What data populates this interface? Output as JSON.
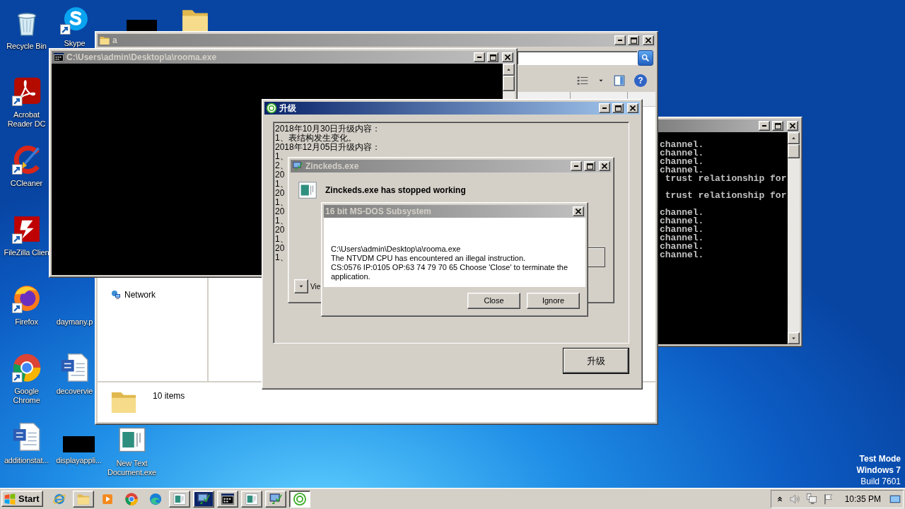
{
  "desktop_icons": [
    {
      "kind": "recycle-bin",
      "label": "Recycle Bin",
      "shortcut": false
    },
    {
      "kind": "chat-app",
      "label": "Skype",
      "shortcut": true
    },
    {
      "kind": "redacted"
    },
    {
      "kind": "folder",
      "shortcut": false
    },
    {
      "kind": "pdf-app",
      "label": "Acrobat Reader DC",
      "shortcut": true
    },
    {
      "kind": "cleaner-app",
      "label": "CCleaner",
      "shortcut": true
    },
    {
      "kind": "ftp-app",
      "label": "FileZilla Clien",
      "shortcut": true
    },
    {
      "kind": "fox-browser",
      "label": "Firefox",
      "shortcut": true
    },
    {
      "kind": "blank",
      "label": "daymany.p"
    },
    {
      "kind": "chrome-browser",
      "label": "Google Chrome",
      "shortcut": true
    },
    {
      "kind": "word-doc",
      "label": "decovervie",
      "shortcut": false
    },
    {
      "kind": "word-doc",
      "label": "additionstat...",
      "shortcut": false
    },
    {
      "kind": "redacted",
      "label": "displayappli..."
    },
    {
      "kind": "app-window",
      "label": "New Text Document.exe",
      "shortcut": false
    }
  ],
  "system_text": [
    "Test Mode",
    "Windows 7",
    "Build 7601"
  ],
  "server_console": {
    "active": false,
    "lines": [
      {
        "text": "channel.",
        "blank_after": false
      },
      {
        "text": "channel.",
        "blank_after": false
      },
      {
        "text": "channel.",
        "blank_after": false
      },
      {
        "text": "channel.",
        "blank_after": false
      },
      {
        "text": " trust relationship for",
        "blank_after": true
      },
      {
        "text": " trust relationship for",
        "blank_after": true
      },
      {
        "text": "channel.",
        "blank_after": false
      },
      {
        "text": "channel.",
        "blank_after": false
      },
      {
        "text": "channel.",
        "blank_after": false
      },
      {
        "text": "channel.",
        "blank_after": false
      },
      {
        "text": "channel.",
        "blank_after": false
      },
      {
        "text": "channel.",
        "blank_after": false
      }
    ]
  },
  "explorer_window": {
    "title": "a",
    "active": false,
    "help_button": "?",
    "nav_items": [
      "Network"
    ],
    "status": "10 items"
  },
  "console_window": {
    "title": "C:\\Users\\admin\\Desktop\\a\\rooma.exe",
    "active": false
  },
  "upgrade_window": {
    "title": "升级",
    "active": true,
    "log_lines": [
      "2018年10月30日升级内容：",
      "1、表结构发生变化。",
      "2018年12月05日升级内容：",
      "1、",
      "2、",
      "20",
      "1、",
      "20",
      "1、",
      "20",
      "1、",
      "20",
      "1、",
      "20",
      "1、"
    ],
    "button": "升级"
  },
  "crash_dialog": {
    "title": "Zinckeds.exe",
    "active": false,
    "heading": "Zinckeds.exe has stopped working",
    "details_toggle": "Vie"
  },
  "ntvdm_dialog": {
    "title": "16 bit MS-DOS Subsystem",
    "active": false,
    "message_lines": [
      "C:\\Users\\admin\\Desktop\\a\\rooma.exe",
      "The NTVDM CPU has encountered an illegal instruction.",
      "CS:0576 IP:0105 OP:63 74 79 70 65 Choose 'Close' to terminate the application."
    ],
    "buttons": [
      "Close",
      "Ignore"
    ]
  },
  "taskbar": {
    "start": "Start",
    "items": [
      {
        "kind": "ie",
        "running": false,
        "selected": false,
        "flashing": false
      },
      {
        "kind": "folder",
        "running": true,
        "selected": false,
        "flashing": false
      },
      {
        "kind": "media",
        "running": false,
        "selected": false,
        "flashing": false
      },
      {
        "kind": "chrome-browser",
        "running": false,
        "selected": false,
        "flashing": false
      },
      {
        "kind": "edge",
        "running": false,
        "selected": false,
        "flashing": false
      },
      {
        "kind": "app-window",
        "running": true,
        "selected": false,
        "flashing": false
      },
      {
        "kind": "monitor-check",
        "running": true,
        "selected": false,
        "flashing": true
      },
      {
        "kind": "cmd",
        "running": true,
        "selected": false,
        "flashing": false
      },
      {
        "kind": "app-window",
        "running": true,
        "selected": false,
        "flashing": false
      },
      {
        "kind": "monitor-check",
        "running": true,
        "selected": false,
        "flashing": false
      },
      {
        "kind": "upgrade-app",
        "running": true,
        "selected": true,
        "flashing": false
      }
    ],
    "clock": "10:35 PM"
  }
}
